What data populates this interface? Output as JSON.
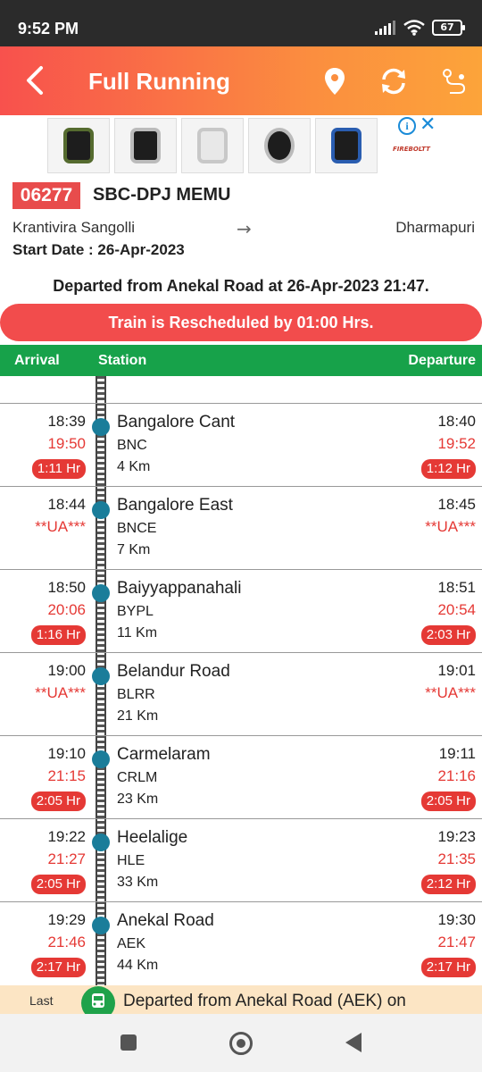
{
  "status_bar": {
    "time": "9:52 PM",
    "battery": "67"
  },
  "app_bar": {
    "title": "Full Running"
  },
  "ad": {
    "brand": "FIREBOLTT",
    "info": "i",
    "close": "✕"
  },
  "train": {
    "number": "06277",
    "name": "SBC-DPJ MEMU",
    "from": "Krantivira Sangolli",
    "to": "Dharmapuri",
    "arrow": "→",
    "start_label": "Start Date : ",
    "start_date": "26-Apr-2023"
  },
  "departed_message": "Departed from Anekal Road at 26-Apr-2023 21:47.",
  "reschedule_message": "Train is Rescheduled by 01:00 Hrs.",
  "table_header": {
    "arrival": "Arrival",
    "station": "Station",
    "departure": "Departure"
  },
  "stations": [
    {
      "name": "Bangalore Cant",
      "code": "BNC",
      "distance": "4 Km",
      "arr_sched": "18:39",
      "arr_actual": "19:50",
      "arr_delay": "1:11 Hr",
      "dep_sched": "18:40",
      "dep_actual": "19:52",
      "dep_delay": "1:12 Hr"
    },
    {
      "name": "Bangalore East",
      "code": "BNCE",
      "distance": "7 Km",
      "arr_sched": "18:44",
      "arr_actual": "**UA***",
      "arr_delay": "",
      "dep_sched": "18:45",
      "dep_actual": "**UA***",
      "dep_delay": ""
    },
    {
      "name": "Baiyyappanahali",
      "code": "BYPL",
      "distance": "11 Km",
      "arr_sched": "18:50",
      "arr_actual": "20:06",
      "arr_delay": "1:16 Hr",
      "dep_sched": "18:51",
      "dep_actual": "20:54",
      "dep_delay": "2:03 Hr"
    },
    {
      "name": "Belandur Road",
      "code": "BLRR",
      "distance": "21 Km",
      "arr_sched": "19:00",
      "arr_actual": "**UA***",
      "arr_delay": "",
      "dep_sched": "19:01",
      "dep_actual": "**UA***",
      "dep_delay": ""
    },
    {
      "name": "Carmelaram",
      "code": "CRLM",
      "distance": "23 Km",
      "arr_sched": "19:10",
      "arr_actual": "21:15",
      "arr_delay": "2:05 Hr",
      "dep_sched": "19:11",
      "dep_actual": "21:16",
      "dep_delay": "2:05 Hr"
    },
    {
      "name": "Heelalige",
      "code": "HLE",
      "distance": "33 Km",
      "arr_sched": "19:22",
      "arr_actual": "21:27",
      "arr_delay": "2:05 Hr",
      "dep_sched": "19:23",
      "dep_actual": "21:35",
      "dep_delay": "2:12 Hr"
    },
    {
      "name": "Anekal Road",
      "code": "AEK",
      "distance": "44 Km",
      "arr_sched": "19:29",
      "arr_actual": "21:46",
      "arr_delay": "2:17 Hr",
      "dep_sched": "19:30",
      "dep_actual": "21:47",
      "dep_delay": "2:17 Hr"
    }
  ],
  "last_strip": {
    "label": "Last",
    "message": "Departed from Anekal Road (AEK) on"
  },
  "colors": {
    "accent_red": "#e53935",
    "header_green": "#17a24a",
    "station_dot": "#1a7d9a"
  }
}
